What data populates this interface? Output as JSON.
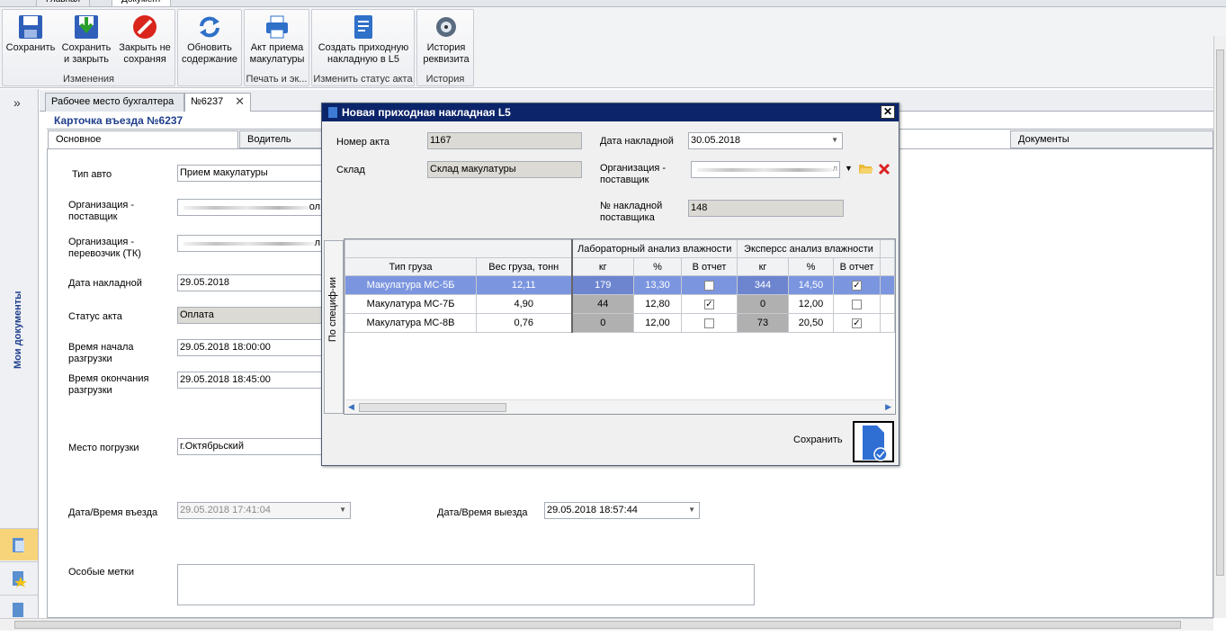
{
  "ribbon": {
    "tabs": [
      "Главная",
      "Документ"
    ],
    "groups": [
      {
        "label": "Изменения",
        "buttons": [
          "Сохранить",
          "Сохранить и закрыть",
          "Закрыть не сохраняя"
        ]
      },
      {
        "label": "",
        "buttons": [
          "Обновить содержание"
        ]
      },
      {
        "label": "Печать и эк...",
        "buttons": [
          "Акт приема макулатуры"
        ]
      },
      {
        "label": "Изменить статус акта",
        "buttons": [
          "Создать приходную накладную в L5"
        ]
      },
      {
        "label": "История",
        "buttons": [
          "История реквизита"
        ]
      }
    ]
  },
  "sidebar": {
    "title": "Мои документы",
    "expand": "»"
  },
  "doc_tabs": [
    "Рабочее место бухгалтера",
    "№6237"
  ],
  "card_title": "Карточка въезда №6237",
  "inner_tabs": [
    "Основное",
    "Водитель",
    "Документы"
  ],
  "form": {
    "car_type_label": "Тип авто",
    "car_type": "Прием макулатуры",
    "supplier_label": "Организация - поставщик",
    "supplier": "ол",
    "carrier_label": "Организация - перевозчик (ТК)",
    "carrier": "л",
    "invoice_date_label": "Дата накладной",
    "invoice_date": "29.05.2018",
    "status_label": "Статус акта",
    "status": "Оплата",
    "unload_start_label": "Время начала разгрузки",
    "unload_start": "29.05.2018 18:00:00",
    "unload_end_label": "Время окончания разгрузки",
    "unload_end": "29.05.2018 18:45:00",
    "loading_place_label": "Место погрузки",
    "loading_place": "г.Октябрьский",
    "entry_label": "Дата/Время въезда",
    "entry": "29.05.2018 17:41:04",
    "exit_label": "Дата/Время выезда",
    "exit": "29.05.2018 18:57:44",
    "notes_label": "Особые метки",
    "notes": ""
  },
  "dialog": {
    "title": "Новая приходная накладная L5",
    "act_no_label": "Номер акта",
    "act_no": "1167",
    "warehouse_label": "Склад",
    "warehouse": "Склад макулатуры",
    "invoice_date_label": "Дата накладной",
    "invoice_date": "30.05.2018",
    "supplier_label": "Организация - поставщик",
    "supplier": "л",
    "supplier_invoice_label": "№ накладной поставщика",
    "supplier_invoice": "148",
    "side_tab": "По специф-ии",
    "save_label": "Сохранить",
    "grid": {
      "group_headers": [
        "Лабораторный анализ влажности",
        "Эксперсс анализ влажности"
      ],
      "columns": [
        "Тип груза",
        "Вес груза, тонн",
        "кг",
        "%",
        "В отчет",
        "кг",
        "%",
        "В отчет"
      ],
      "rows": [
        {
          "type": "Макулатура МС-5Б",
          "weight": "12,11",
          "lab_kg": "179",
          "lab_pct": "13,30",
          "lab_rep": false,
          "exp_kg": "344",
          "exp_pct": "14,50",
          "exp_rep": true
        },
        {
          "type": "Макулатура МС-7Б",
          "weight": "4,90",
          "lab_kg": "44",
          "lab_pct": "12,80",
          "lab_rep": true,
          "exp_kg": "0",
          "exp_pct": "12,00",
          "exp_rep": false
        },
        {
          "type": "Макулатура МС-8В",
          "weight": "0,76",
          "lab_kg": "0",
          "lab_pct": "12,00",
          "lab_rep": false,
          "exp_kg": "73",
          "exp_pct": "20,50",
          "exp_rep": true
        }
      ]
    }
  },
  "colors": {
    "title_bar": "#0b246a",
    "selected_row": "#7b95df",
    "accent_text": "#1f3e8c"
  }
}
